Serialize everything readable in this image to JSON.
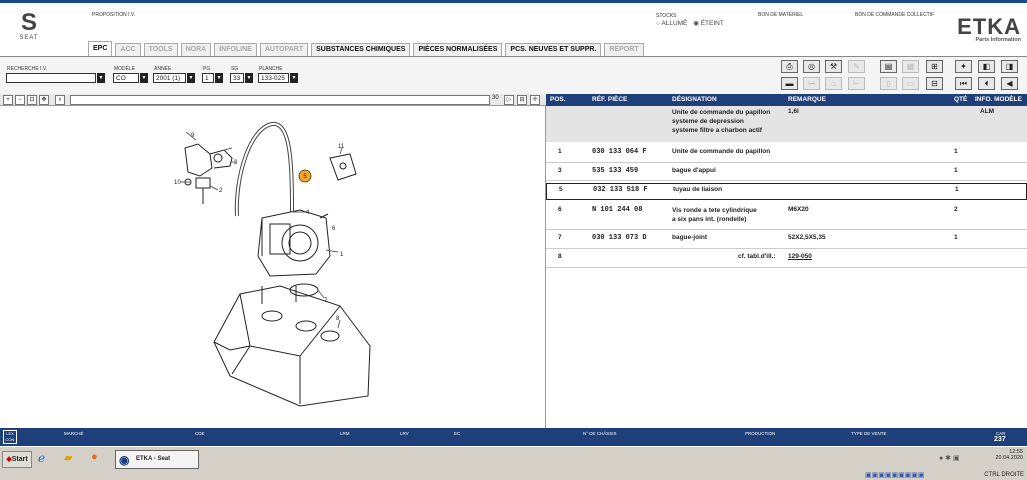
{
  "header": {
    "proposition_label": "PROPOSITION I.V.",
    "brand": "SEAT",
    "stocks_label": "STOCKS",
    "stocks_on": "ALLUMÉ",
    "stocks_off": "ÉTEINT",
    "bon_materiel": "BON DE MATÉRIEL",
    "bon_collectif": "BON DE COMMANDE COLLECTIF",
    "etka_title": "ETKA",
    "etka_sub": "Parts Information"
  },
  "tabs": [
    {
      "label": "EPC"
    },
    {
      "label": "ACC"
    },
    {
      "label": "TOOLS"
    },
    {
      "label": "NORA"
    },
    {
      "label": "INFOLINE"
    },
    {
      "label": "AUTOPART"
    },
    {
      "label": "SUBSTANCES CHIMIQUES"
    },
    {
      "label": "PIÈCES NORMALISÉES"
    },
    {
      "label": "PCS. NEUVES ET SUPPR."
    },
    {
      "label": "REPORT"
    }
  ],
  "filters": {
    "recherche_label": "RECHERCHE I.V.",
    "modele_label": "MODÈLE",
    "modele_value": "CO",
    "annee_label": "ANNÉE",
    "annee_value": "2001 (1)",
    "pg_label": "PG",
    "pg_value": "1",
    "sg_label": "SG",
    "sg_value": "33",
    "planche_label": "PLANCHE",
    "planche_value": "133-025"
  },
  "viewer": {
    "zoom_value": "30",
    "callouts": [
      "1",
      "2",
      "3",
      "4",
      "5",
      "6",
      "7",
      "8",
      "9",
      "10",
      "11"
    ]
  },
  "table": {
    "headers": {
      "pos": "POS.",
      "ref": "RÉF. PIÈCE",
      "des": "DÉSIGNATION",
      "rem": "REMARQUE",
      "qte": "QTÉ",
      "info": "INFO. MODÈLE"
    },
    "intro": {
      "des1": "Unite de commande du papillon",
      "des2": "systeme de depression",
      "des3": "systeme filtre a charbon actif",
      "rem": "1,6l",
      "info": "ALM"
    },
    "rows": [
      {
        "pos": "1",
        "ref": "030 133 064 F",
        "des": "Unite de commande du papillon",
        "des2": "",
        "rem": "",
        "qte": "1"
      },
      {
        "pos": "3",
        "ref": "535 133 459",
        "des": "bague d'appui",
        "des2": "",
        "rem": "",
        "qte": "1"
      },
      {
        "pos": "5",
        "ref": "032 133 518 F",
        "des": "tuyau de liaison",
        "des2": "",
        "rem": "",
        "qte": "1"
      },
      {
        "pos": "6",
        "ref": "N   101 244 08",
        "des": "Vis ronde a tete cylindrique",
        "des2": "a six pans int. (rondelle)",
        "rem": "M6X20",
        "qte": "2"
      },
      {
        "pos": "7",
        "ref": "030 133 073 D",
        "des": "bague-joint",
        "des2": "",
        "rem": "52X2,5X5,35",
        "qte": "1"
      },
      {
        "pos": "8",
        "ref": "",
        "des": "cf. tabl.d'ill.:",
        "des2": "",
        "rem": "129-050",
        "qte": ""
      }
    ]
  },
  "statusbar": {
    "marche": "MARCHÉ",
    "cde": "CDE",
    "lrm": "LRM",
    "lrv": "LRV",
    "ec": "EC",
    "chassis": "N° DE CHÂSSIS",
    "production": "PRODUCTION",
    "type_vente": "TYPE DE VENTE",
    "car_label": "CAR",
    "car_value": "237"
  },
  "taskbar": {
    "start": "Start",
    "task_label": "ETKA - Seat",
    "time": "12:55",
    "date": "20.04.2020",
    "keys": "CTRL DROITE"
  },
  "colors": {
    "navy": "#1f3f7a",
    "callout_orange": "#f5a623"
  }
}
